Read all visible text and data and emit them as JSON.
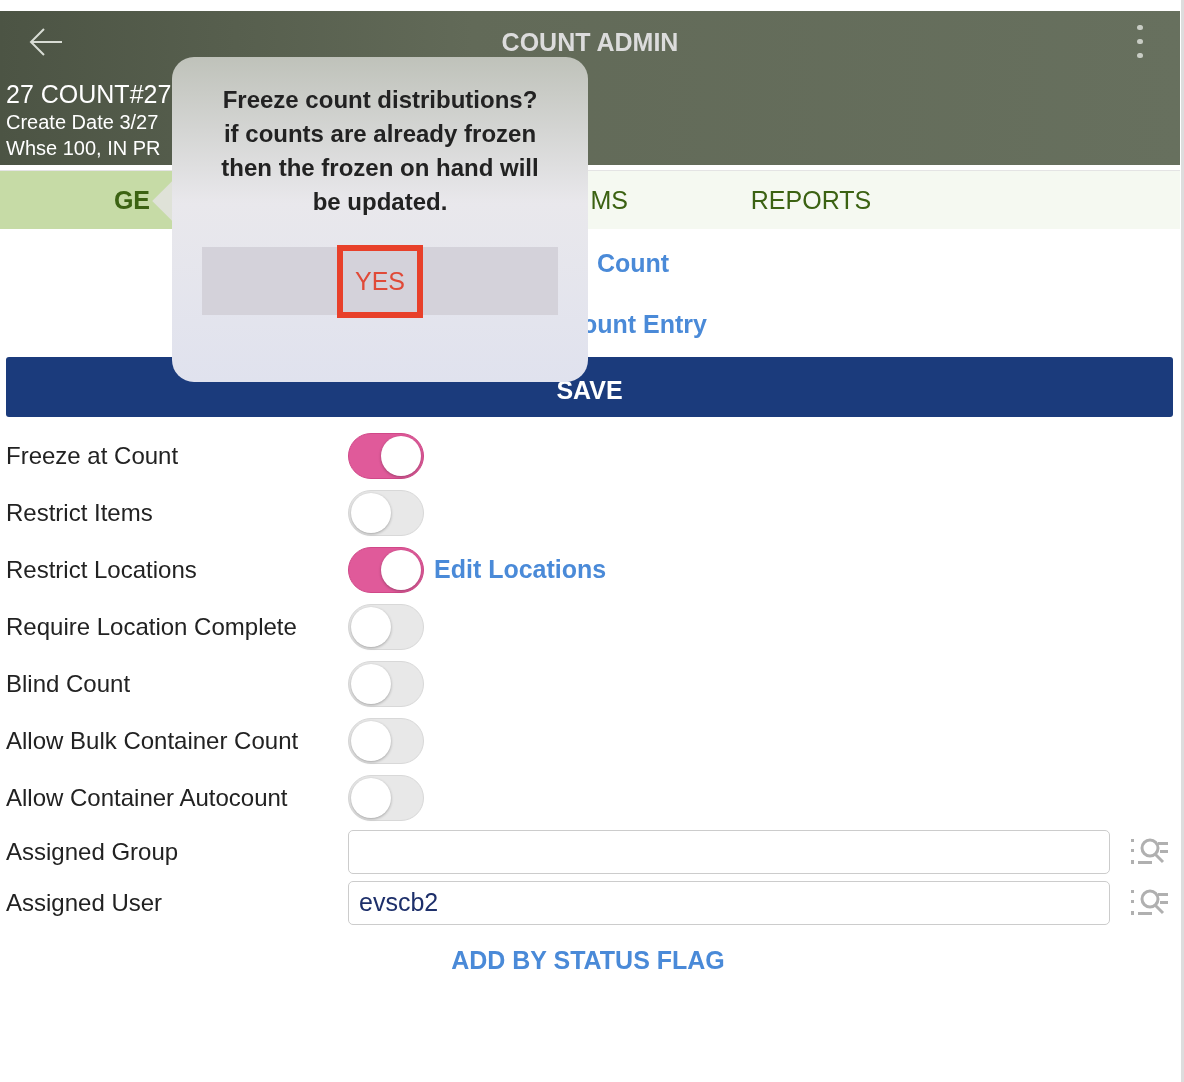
{
  "header": {
    "title": "COUNT ADMIN",
    "subtitle_lines": [
      "27 COUNT#27",
      "Create Date 3/27",
      "Whse 100, IN PR"
    ]
  },
  "tabs": [
    {
      "label": "GE",
      "selected": true
    },
    {
      "label": "MS",
      "selected": false
    },
    {
      "label": "REPORTS",
      "selected": false
    }
  ],
  "links": [
    "Count",
    "ount Entry"
  ],
  "save_button": "SAVE",
  "settings": [
    {
      "label": "Freeze at Count",
      "on": true
    },
    {
      "label": "Restrict Items",
      "on": false
    },
    {
      "label": "Restrict Locations",
      "on": true,
      "link": "Edit Locations"
    },
    {
      "label": "Require Location Complete",
      "on": false
    },
    {
      "label": "Blind Count",
      "on": false
    },
    {
      "label": "Allow Bulk Container Count",
      "on": false
    },
    {
      "label": "Allow Container Autocount",
      "on": false
    }
  ],
  "fields": [
    {
      "label": "Assigned Group"
    },
    {
      "label": "Assigned User",
      "value": "evscb2"
    }
  ],
  "add_link": "ADD BY STATUS FLAG",
  "popover": {
    "message": "Freeze count distributions? if counts are already frozen then the frozen on hand will be updated.",
    "button": "YES",
    "highlighted": true
  }
}
